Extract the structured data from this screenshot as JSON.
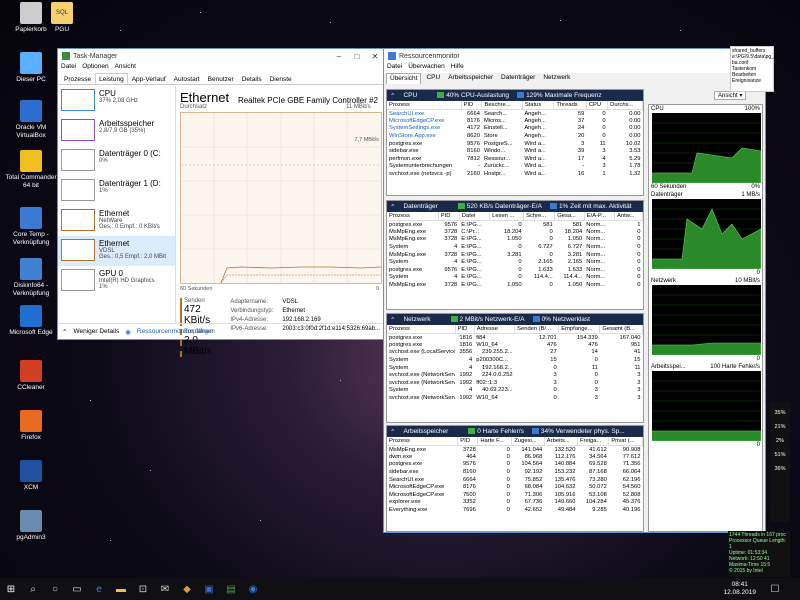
{
  "desktop": {
    "icons": [
      {
        "label": "Papierkorb",
        "color": "#ccc"
      },
      {
        "label": "Dieser PC",
        "color": "#5ab0ff"
      },
      {
        "label": "Oracle VM VirtualBox",
        "color": "#2a6fd0"
      },
      {
        "label": "Total Commander 64 bit",
        "color": "#f0c020"
      },
      {
        "label": "Core Temp - Verknüpfung",
        "color": "#3a7ad0"
      },
      {
        "label": "Diskinfo64 - Verknüpfung",
        "color": "#4080d0"
      },
      {
        "label": "Microsoft Edge",
        "color": "#1f6fd0"
      },
      {
        "label": "CCleaner",
        "color": "#d04020"
      },
      {
        "label": "Firefox",
        "color": "#e86a20"
      },
      {
        "label": "XCM",
        "color": "#2050a0"
      },
      {
        "label": "pgAdmin3",
        "color": "#6a8ab0"
      }
    ],
    "top_icon": {
      "label": "PGU",
      "badge": "SQL"
    }
  },
  "taskmgr": {
    "title": "Task-Manager",
    "menu": [
      "Datei",
      "Optionen",
      "Ansicht"
    ],
    "tabs": [
      "Prozesse",
      "Leistung",
      "App-Verlauf",
      "Autostart",
      "Benutzer",
      "Details",
      "Dienste"
    ],
    "side": [
      {
        "t1": "CPU",
        "t2": "37% 2,08 GHz"
      },
      {
        "t1": "Arbeitsspeicher",
        "t2": "2,8/7,9 GB (35%)"
      },
      {
        "t1": "Datenträger 0 (C:",
        "t2": "0%"
      },
      {
        "t1": "Datenträger 1 (D:",
        "t2": "1%"
      },
      {
        "t1": "Ethernet",
        "t2": "NetWare",
        "t3": "Ges.: 0 Empf.: 0 KBit/s"
      },
      {
        "t1": "Ethernet",
        "t2": "VDSL",
        "t3": "Ges.: 0,5 Empf.: 2,0 MBit"
      },
      {
        "t1": "GPU 0",
        "t2": "Intel(R) HD Graphics",
        "t3": "1%"
      }
    ],
    "main": {
      "heading": "Ethernet",
      "device": "Realtek PCIe GBE Family Controller #2",
      "chart_label": "Durchsatz",
      "chart_max": "11 MBit/s",
      "chart_mid": "7,7 MBit/s",
      "time_label": "60 Sekunden",
      "time_end": "0",
      "send_label": "Senden",
      "send_value": "472 KBit/s",
      "recv_label": "Empfangen",
      "recv_value": "2,0 MBit/s",
      "props": [
        {
          "k": "Adaptername:",
          "v": "VDSL"
        },
        {
          "k": "Verbindungstyp:",
          "v": "Ethernet"
        },
        {
          "k": "IPv4-Adresse:",
          "v": "192.168.2.169"
        },
        {
          "k": "IPv6-Adresse:",
          "v": "2003:c3:0f0d:2f1d:e114:5326:69ab..."
        }
      ]
    },
    "footer": {
      "less": "Weniger Details",
      "resmon": "Ressourcenmonitor öffnen"
    }
  },
  "resmon": {
    "title": "Ressourcenmonitor",
    "menu": [
      "Datei",
      "Überwachen",
      "Hilfe"
    ],
    "tabs": [
      "Übersicht",
      "CPU",
      "Arbeitsspeicher",
      "Datenträger",
      "Netzwerk"
    ],
    "ansicht": "Ansicht",
    "cpu": {
      "name": "CPU",
      "s1": "40% CPU-Auslastung",
      "s2": "129% Maximale Frequenz",
      "cols": [
        "Prozess",
        "PID",
        "Beschre...",
        "Status",
        "Threads",
        "CPU",
        "Durchs..."
      ],
      "rows": [
        [
          "SearchUI.exe",
          "6664",
          "Search...",
          "Angeh...",
          "59",
          "0",
          "0.00"
        ],
        [
          "MicrosoftEdgeCP.exe",
          "8176",
          "Micros...",
          "Angeh...",
          "37",
          "0",
          "0.00"
        ],
        [
          "SystemSettings.exe",
          "4172",
          "Einstell...",
          "Angeh...",
          "24",
          "0",
          "0.00"
        ],
        [
          "WinStore.App.exe",
          "8620",
          "Store",
          "Angeh...",
          "20",
          "0",
          "0.00"
        ],
        [
          "postgres.exe",
          "9576",
          "PostgreS...",
          "Wird a...",
          "3",
          "11",
          "10.02"
        ],
        [
          "sidebar.exe",
          "8160",
          "Windo...",
          "Wird a...",
          "39",
          "3",
          "3.53"
        ],
        [
          "perfmon.exe",
          "7812",
          "Ressour...",
          "Wird a...",
          "17",
          "4",
          "5.29"
        ],
        [
          "Systemunterbrechungen",
          "-",
          "Zurückc...",
          "Wird a...",
          "-",
          "3",
          "1.78"
        ],
        [
          "svchost.exe (netsvcs -p)",
          "2160",
          "Hostpr...",
          "Wird a...",
          "16",
          "1",
          "1.32"
        ]
      ]
    },
    "disk": {
      "name": "Datenträger",
      "s1": "520 KB/s Datenträger-E/A",
      "s2": "1% Zeit mit max. Aktivität",
      "cols": [
        "Prozess",
        "PID",
        "Datei",
        "Lesen ...",
        "Schre...",
        "Gesa...",
        "E/A-P...",
        "Antw..."
      ],
      "rows": [
        [
          "postgres.exe",
          "9576",
          "E:\\PG...",
          "0",
          "581",
          "581",
          "Norm...",
          "1"
        ],
        [
          "MsMpEng.exe",
          "3728",
          "C:\\Pr...",
          "18.204",
          "0",
          "18.204",
          "Norm...",
          "0"
        ],
        [
          "MsMpEng.exe",
          "3728",
          "E:\\PG...",
          "1.050",
          "0",
          "1.050",
          "Norm...",
          "0"
        ],
        [
          "System",
          "4",
          "E:\\PG...",
          "0",
          "6.727",
          "6.727",
          "Norm...",
          "0"
        ],
        [
          "MsMpEng.exe",
          "3728",
          "E:\\PG...",
          "3.281",
          "0",
          "3.281",
          "Norm...",
          "0"
        ],
        [
          "System",
          "4",
          "E:\\PG...",
          "0",
          "2.165",
          "2.165",
          "Norm...",
          "0"
        ],
        [
          "postgres.exe",
          "9576",
          "E:\\PG...",
          "0",
          "1.633",
          "1.633",
          "Norm...",
          "0"
        ],
        [
          "System",
          "4",
          "E:\\PG...",
          "0",
          "114.4...",
          "114.4...",
          "Norm...",
          "0"
        ],
        [
          "MsMpEng.exe",
          "3728",
          "E:\\PG...",
          "1.050",
          "0",
          "1.050",
          "Norm...",
          "0"
        ]
      ]
    },
    "net": {
      "name": "Netzwerk",
      "s1": "2 MBit/s Netzwerk-E/A",
      "s2": "0% Netzwerklast",
      "cols": [
        "Prozess",
        "PID",
        "Adresse",
        "Senden (B/...",
        "Empfange...",
        "Gesamt (B..."
      ],
      "rows": [
        [
          "postgres.exe",
          "1816",
          "fi84",
          "12.701",
          "154.339",
          "167.040"
        ],
        [
          "postgres.exe",
          "1816",
          "W10_64",
          "476",
          "476",
          "951"
        ],
        [
          "svchost.exe (LocalServiceAndNo...",
          "3556",
          "239.255.2...",
          "27",
          "14",
          "41"
        ],
        [
          "System",
          "4",
          "p200300C...",
          "15",
          "0",
          "15"
        ],
        [
          "System",
          "4",
          "192.168.2...",
          "0",
          "11",
          "11"
        ],
        [
          "svchost.exe (NetworkService -p)",
          "1992",
          "224.0.0.252",
          "3",
          "0",
          "3"
        ],
        [
          "svchost.exe (NetworkService -p)",
          "1992",
          "ff02::1:3",
          "3",
          "0",
          "3"
        ],
        [
          "System",
          "4",
          "40.69.223...",
          "0",
          "3",
          "3"
        ],
        [
          "svchost.exe (NetworkService -p)",
          "1992",
          "W10_64",
          "0",
          "3",
          "3"
        ]
      ]
    },
    "mem": {
      "name": "Arbeitsspeicher",
      "s1": "0 Harte Fehler/s",
      "s2": "34% Verwendeter phys. Sp...",
      "cols": [
        "Prozess",
        "PID",
        "Harte F...",
        "Zugesi...",
        "Arbeits...",
        "Freiga...",
        "Privat (..."
      ],
      "rows": [
        [
          "MsMpEng.exe",
          "3728",
          "0",
          "141.044",
          "132.520",
          "41.612",
          "90.908"
        ],
        [
          "dwm.exe",
          "464",
          "0",
          "86.968",
          "112.176",
          "34.564",
          "77.612"
        ],
        [
          "postgres.exe",
          "9576",
          "0",
          "104.564",
          "140.884",
          "69.528",
          "71.356"
        ],
        [
          "sidebar.exe",
          "8160",
          "0",
          "92.192",
          "153.232",
          "87.168",
          "66.064"
        ],
        [
          "SearchUI.exe",
          "6664",
          "0",
          "75.852",
          "135.476",
          "73.280",
          "62.196"
        ],
        [
          "MicrosoftEdgeCP.exe",
          "8176",
          "0",
          "68.084",
          "104.632",
          "50.072",
          "54.560"
        ],
        [
          "MicrosoftEdgeCP.exe",
          "7500",
          "0",
          "71.306",
          "105.916",
          "53.108",
          "52.808"
        ],
        [
          "explorer.exe",
          "3352",
          "0",
          "67.736",
          "149.660",
          "104.284",
          "45.376"
        ],
        [
          "Everything.exe",
          "7696",
          "0",
          "42.652",
          "49.484",
          "9.285",
          "40.196"
        ]
      ]
    },
    "graphs": [
      {
        "label": "CPU",
        "max": "100%",
        "bottom_l": "60 Sekunden",
        "bottom_r": "0%"
      },
      {
        "label": "Datenträger",
        "max": "1 MB/s",
        "bottom_l": "",
        "bottom_r": "0"
      },
      {
        "label": "Netzwerk",
        "max": "10 MBit/s",
        "bottom_l": "",
        "bottom_r": "0"
      },
      {
        "label": "Arbeitsspei...",
        "max": "100 Harte Fehler/s",
        "bottom_l": "",
        "bottom_r": "0"
      }
    ]
  },
  "side_note": {
    "lines": [
      "shared_buffers",
      "e:\\PG\\9.5\\data\\pg_h",
      "ba.conf",
      "Tastenkom",
      "Bearbeiten",
      "Ereignisanze"
    ]
  },
  "gadget": {
    "lines": [
      "1744 Threads in 167 proc",
      "Processor Queue Length: 1",
      "Uptime: 01:53:34",
      "Network: 12:50 41",
      "Maxima-Time 15:5",
      "© 2015 by Intel"
    ]
  },
  "rgad": {
    "values": [
      "35%",
      "21%",
      "2%",
      "51%",
      "36%"
    ]
  },
  "clock": {
    "time": "08:41",
    "date": "12.08.2019"
  }
}
